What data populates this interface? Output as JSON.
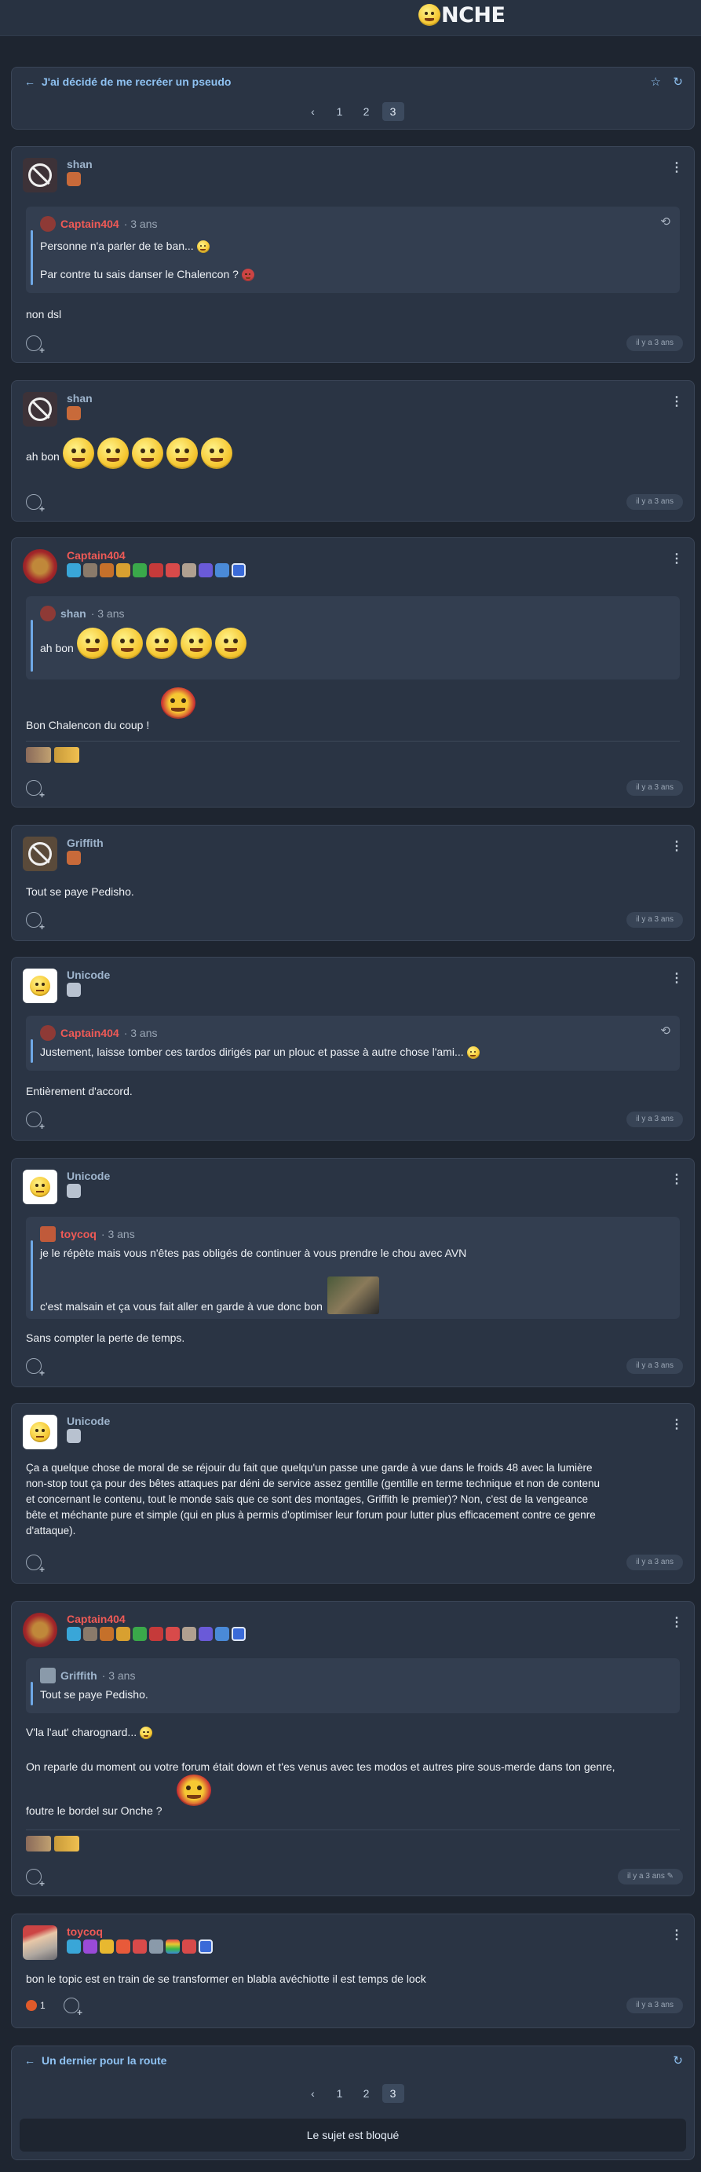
{
  "site": {
    "logo_text": "NCHE"
  },
  "topic": {
    "title": "J'ai décidé de me recréer un pseudo",
    "pages": [
      "1",
      "2",
      "3"
    ],
    "current_page": "3",
    "prev_symbol": "‹",
    "back_symbol": "←",
    "star_symbol": "☆",
    "refresh_symbol": "↻"
  },
  "ui": {
    "menu_symbol": "⋮",
    "history_symbol": "⟲",
    "edit_symbol": "✎"
  },
  "posts": [
    {
      "author": "shan",
      "quote_author": "Captain404",
      "quote_time": "· 3 ans",
      "quote_line1": "Personne n'a parler de te ban...",
      "quote_line2": "Par contre tu sais danser le Chalencon ?",
      "text": "non dsl",
      "time": "il y a 3 ans"
    },
    {
      "author": "shan",
      "text": "ah bon",
      "time": "il y a 3 ans"
    },
    {
      "author": "Captain404",
      "quote_author": "shan",
      "quote_time": "· 3 ans",
      "quote_line1": "ah bon",
      "text": "Bon Chalencon du coup !",
      "time": "il y a 3 ans"
    },
    {
      "author": "Griffith",
      "text": "Tout se paye Pedisho.",
      "time": "il y a 3 ans"
    },
    {
      "author": "Unicode",
      "quote_author": "Captain404",
      "quote_time": "· 3 ans",
      "quote_line1": "Justement, laisse tomber ces tardos dirigés par un plouc et passe à autre chose l'ami...",
      "text": "Entièrement d'accord.",
      "time": "il y a 3 ans"
    },
    {
      "author": "Unicode",
      "quote_author": "toycoq",
      "quote_time": "· 3 ans",
      "quote_line1": "je le répète mais vous n'êtes pas obligés de continuer à vous prendre le chou avec AVN",
      "quote_line2": "c'est malsain et ça vous fait aller en garde à vue donc bon",
      "text": "Sans compter la perte de temps.",
      "time": "il y a 3 ans"
    },
    {
      "author": "Unicode",
      "text_lines": [
        "Ça a quelque chose de moral de se réjouir du fait que quelqu'un passe une garde à vue dans le froids 48 avec la lumière",
        "non-stop tout ça pour des bêtes attaques par déni de service assez gentille (gentille en terme technique et non de contenu",
        "et concernant le contenu, tout le monde sais que ce sont des montages, Griffith le premier)? Non, c'est de la vengeance",
        "bête et méchante pure et simple (qui en plus à permis d'optimiser leur forum pour lutter plus efficacement contre ce genre",
        "d'attaque)."
      ],
      "time": "il y a 3 ans"
    },
    {
      "author": "Captain404",
      "quote_author": "Griffith",
      "quote_time": "· 3 ans",
      "quote_line1": "Tout se paye Pedisho.",
      "text1": "V'la l'aut' charognard...",
      "text2": "On reparle du moment ou votre forum était down et t'es venus avec tes modos et autres pire sous-merde dans ton genre,",
      "text3": "foutre le bordel sur Onche ?",
      "time": "il y a 3 ans"
    },
    {
      "author": "toycoq",
      "text": "bon le topic est en train de se transformer en blabla avéchiotte il est temps de lock",
      "reaction_count": "1",
      "time": "il y a 3 ans"
    }
  ],
  "next_topic": {
    "title": "Un dernier pour la route",
    "locked_label": "Le sujet est bloqué"
  },
  "colors": {
    "accent": "#8fc2f2",
    "author_red": "#ef5a56",
    "panel": "#2a3444"
  }
}
